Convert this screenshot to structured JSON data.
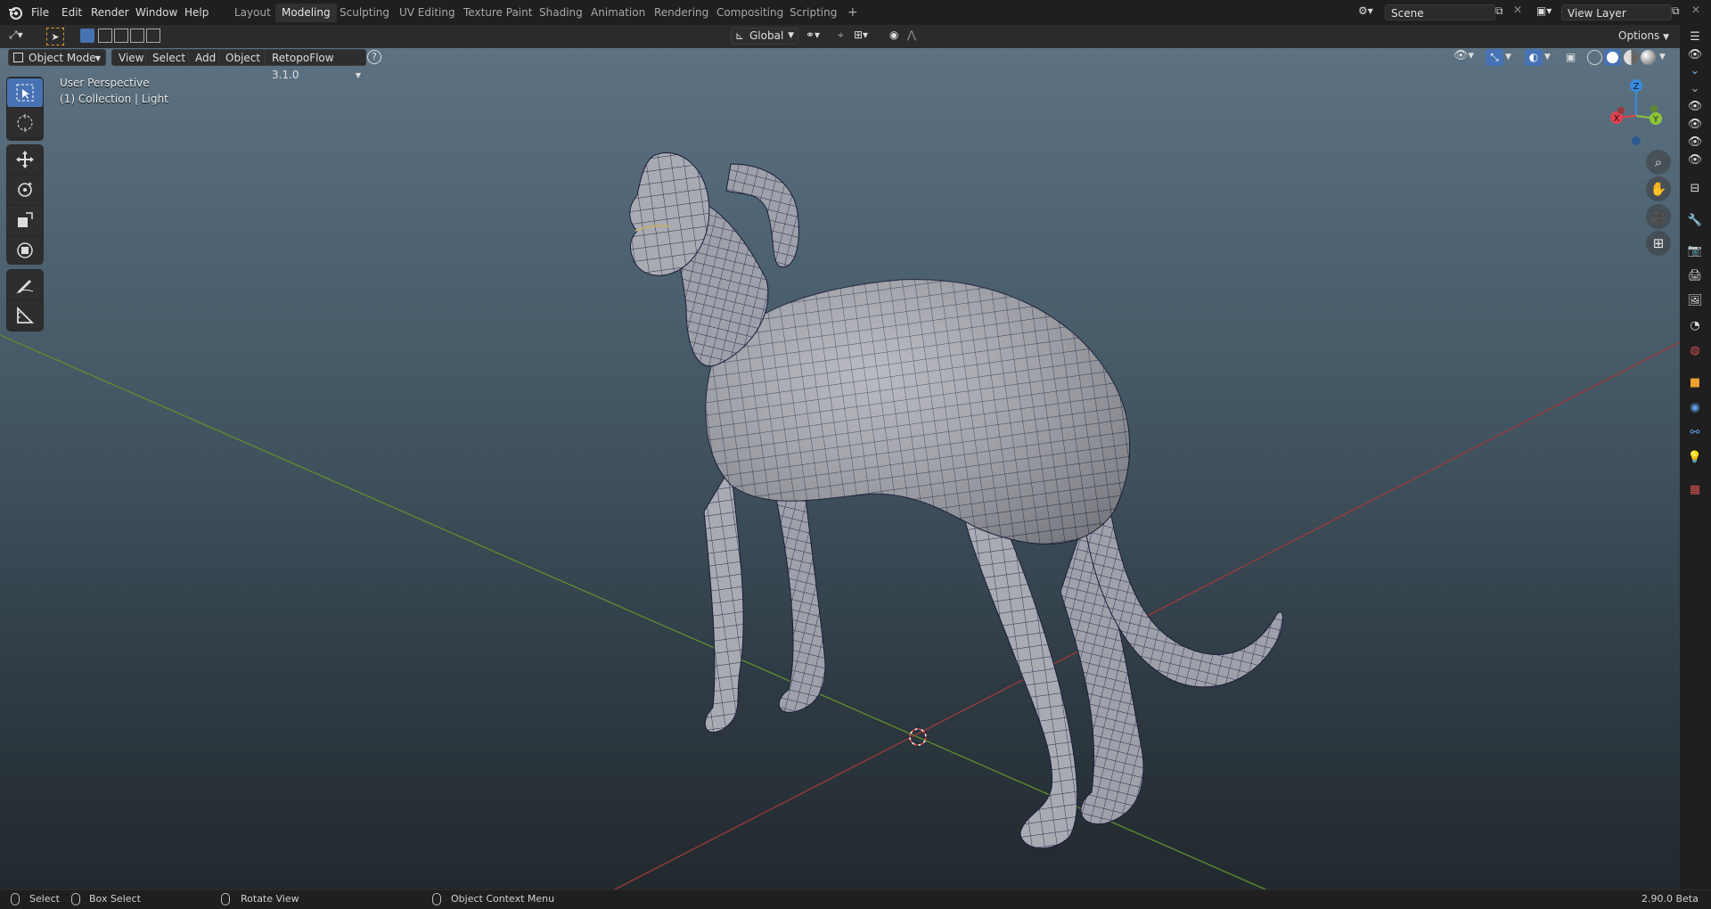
{
  "topbar": {
    "menus": [
      "File",
      "Edit",
      "Render",
      "Window",
      "Help"
    ],
    "workspace_tabs": [
      "Layout",
      "Modeling",
      "Sculpting",
      "UV Editing",
      "Texture Paint",
      "Shading",
      "Animation",
      "Rendering",
      "Compositing",
      "Scripting"
    ],
    "active_tab": "Modeling",
    "add_tab_label": "+",
    "scene_label": "Scene",
    "view_layer_label": "View Layer"
  },
  "toolheader": {
    "orientation_label": "Global",
    "options_label": "Options"
  },
  "viewheader": {
    "mode_label": "Object Mode",
    "view_label": "View",
    "select_label": "Select",
    "add_label": "Add",
    "object_label": "Object",
    "addon_label": "RetopoFlow 3.1.0",
    "help_label": "?"
  },
  "viewport": {
    "perspective_label": "User Perspective",
    "collection_label": "(1) Collection | Light",
    "gizmo": {
      "x": "X",
      "y": "Y",
      "z": "Z"
    }
  },
  "statusbar": {
    "select_label": "Select",
    "box_select_label": "Box Select",
    "rotate_label": "Rotate View",
    "context_menu_label": "Object Context Menu",
    "version_label": "2.90.0 Beta"
  },
  "colors": {
    "accent": "#4772b3",
    "x_axis": "#e0434f",
    "y_axis": "#8cc43b",
    "z_axis": "#3b8be0"
  },
  "icons": [
    "blender-logo-icon",
    "select-box-icon",
    "cursor-icon",
    "move-icon",
    "rotate-icon",
    "scale-icon",
    "transform-icon",
    "annotate-icon",
    "measure-icon",
    "zoom-icon",
    "hand-icon",
    "camera-icon",
    "grid-icon"
  ]
}
